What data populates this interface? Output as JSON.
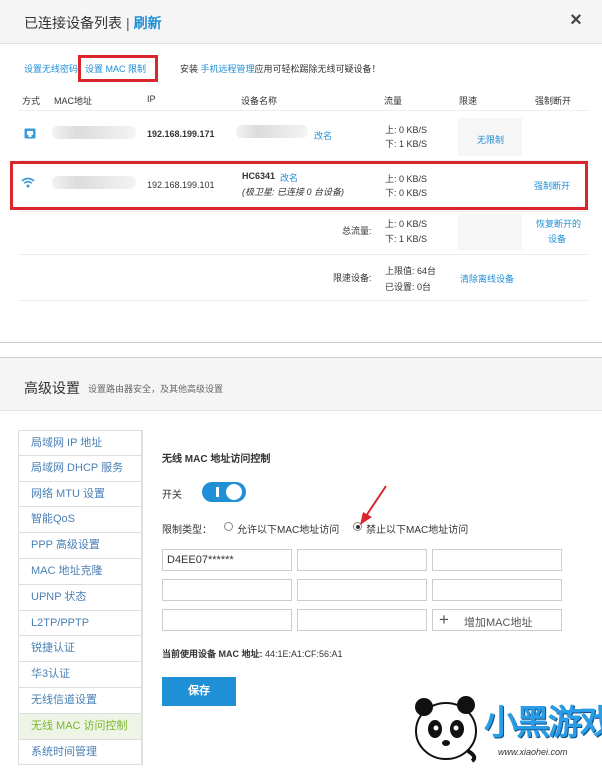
{
  "panel1": {
    "title": "已连接设备列表",
    "separator": "|",
    "refresh": "刷新",
    "close_icon": "×",
    "links": {
      "wireless_password": "设置无线密码",
      "mac_limit": "设置 MAC 限制"
    },
    "tip": {
      "prefix": "安装",
      "app": "手机远程管理",
      "suffix": "应用可轻松踢除无线可疑设备！"
    },
    "columns": [
      "方式",
      "MAC地址",
      "IP",
      "设备名称",
      "流量",
      "限速",
      "强制断开"
    ],
    "rows": [
      {
        "type_icon": "lan-icon",
        "ip": "192.168.199.171",
        "rename": "改名",
        "up": "上: 0 KB/S",
        "down": "下: 1 KB/S",
        "limit": "无限制"
      },
      {
        "type_icon": "wifi-icon",
        "ip": "192.168.199.101",
        "name": "HC6341",
        "rename": "改名",
        "note": "(极卫星: 已连接 0 台设备)",
        "up": "上: 0 KB/S",
        "down": "下: 0 KB/S",
        "action": "强制断开"
      }
    ],
    "total": {
      "label": "总流量:",
      "up": "上: 0 KB/S",
      "down": "下: 1 KB/S",
      "action_line1": "恢复断开的",
      "action_line2": "设备"
    },
    "limit_devices": {
      "label": "限速设备:",
      "max": "上限值: 64台",
      "set": "已设置: 0台",
      "action": "清除离线设备"
    }
  },
  "panel2": {
    "title": "高级设置",
    "subtitle": "设置路由器安全，及其他高级设置",
    "sidebar": [
      "局域网 IP 地址",
      "局域网 DHCP 服务",
      "网络 MTU 设置",
      "智能QoS",
      "PPP 高级设置",
      "MAC 地址克隆",
      "UPNP 状态",
      "L2TP/PPTP",
      "锐捷认证",
      "华3认证",
      "无线信道设置",
      "无线 MAC 访问控制",
      "系统时间管理"
    ],
    "active_index": 11,
    "section_title": "无线 MAC 地址访问控制",
    "switch_label": "开关",
    "switch_on": true,
    "limit_type_label": "限制类型：",
    "option_allow": "允许以下MAC地址访问",
    "option_deny": "禁止以下MAC地址访问",
    "selected_option": "deny",
    "mac_values": [
      "D4EE07******",
      "",
      "",
      "",
      "",
      "",
      "",
      ""
    ],
    "add_mac": "增加MAC地址",
    "current_mac_label": "当前使用设备 MAC 地址:",
    "current_mac": "44:1E:A1:CF:56:A1",
    "save": "保存"
  },
  "watermark": {
    "brand": "小黑游戏",
    "url": "www.xiaohei.com"
  },
  "colors": {
    "accent": "#1f8fd6",
    "highlight_red": "#d9262c",
    "active_green": "#78b82a"
  }
}
